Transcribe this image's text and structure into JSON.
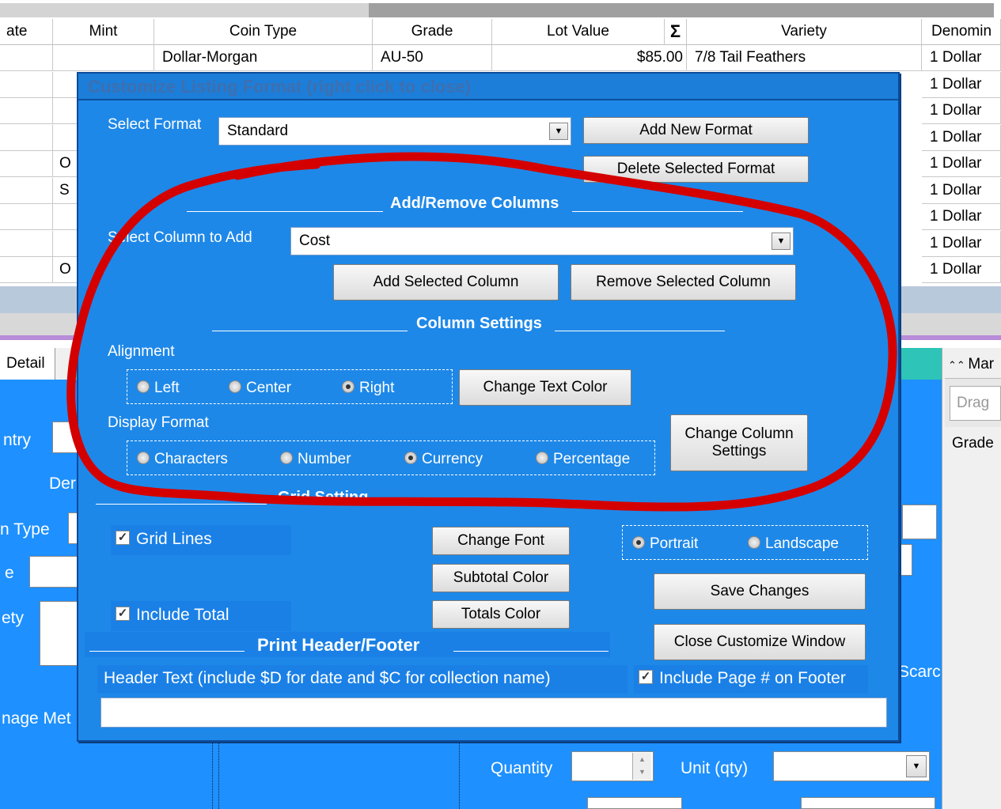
{
  "grid": {
    "headers": [
      "ate",
      "Mint",
      "Coin Type",
      "Grade",
      "Lot Value",
      "Σ",
      "Variety",
      "Denomin"
    ],
    "first_row": {
      "coin_type": "Dollar-Morgan",
      "grade": "AU-50",
      "lot_value": "$85.00",
      "variety": "7/8 Tail Feathers",
      "denomination": "1 Dollar"
    },
    "denominations": [
      "1 Dollar",
      "1 Dollar",
      "1 Dollar",
      "1 Dollar",
      "1 Dollar",
      "1 Dollar",
      "1 Dollar",
      "1 Dollar",
      "1 Dollar"
    ],
    "mint_letters": [
      "",
      "",
      "",
      "",
      "O",
      "S",
      "",
      "",
      "O"
    ]
  },
  "lower": {
    "detail_tab": "Detail",
    "entry_label": "ntry",
    "den_label": "Der",
    "type_label": "n Type",
    "e_label": "e",
    "ety_label": "ety",
    "image_label": "nage Met",
    "quantity_label": "Quantity",
    "unit_label": "Unit (qty)",
    "scarc_label": "Scarc",
    "right_panel": {
      "header": "Mar",
      "drag": "Drag",
      "grade": "Grade"
    }
  },
  "dialog": {
    "title": "Customize Listing Format (right click to close)",
    "select_format_label": "Select Format",
    "format_value": "Standard",
    "add_new_format": "Add New Format",
    "delete_selected_format": "Delete Selected Format",
    "add_remove_header": "Add/Remove Columns",
    "select_column_label": "Select Column to Add",
    "column_value": "Cost",
    "add_selected_column": "Add Selected Column",
    "remove_selected_column": "Remove Selected Column",
    "column_settings_header": "Column Settings",
    "alignment_label": "Alignment",
    "align_left": "Left",
    "align_center": "Center",
    "align_right": "Right",
    "change_text_color": "Change Text Color",
    "display_format_label": "Display Format",
    "fmt_characters": "Characters",
    "fmt_number": "Number",
    "fmt_currency": "Currency",
    "fmt_percentage": "Percentage",
    "change_column_settings": "Change Column Settings",
    "grid_settings_header": "Grid Setting",
    "grid_lines": "Grid Lines",
    "include_total": "Include Total",
    "change_font": "Change Font",
    "subtotal_color": "Subtotal Color",
    "totals_color": "Totals Color",
    "portrait": "Portrait",
    "landscape": "Landscape",
    "save_changes": "Save Changes",
    "close_customize": "Close Customize Window",
    "print_header_footer": "Print Header/Footer",
    "header_text_label": "Header Text (include $D for date and $C for collection name)",
    "include_page_footer": "Include Page # on Footer",
    "header_text_value": ""
  },
  "colors": {
    "dialog_bg": "#1e88e8",
    "annotation": "#d40000",
    "lower_bg": "#1e90ff"
  }
}
